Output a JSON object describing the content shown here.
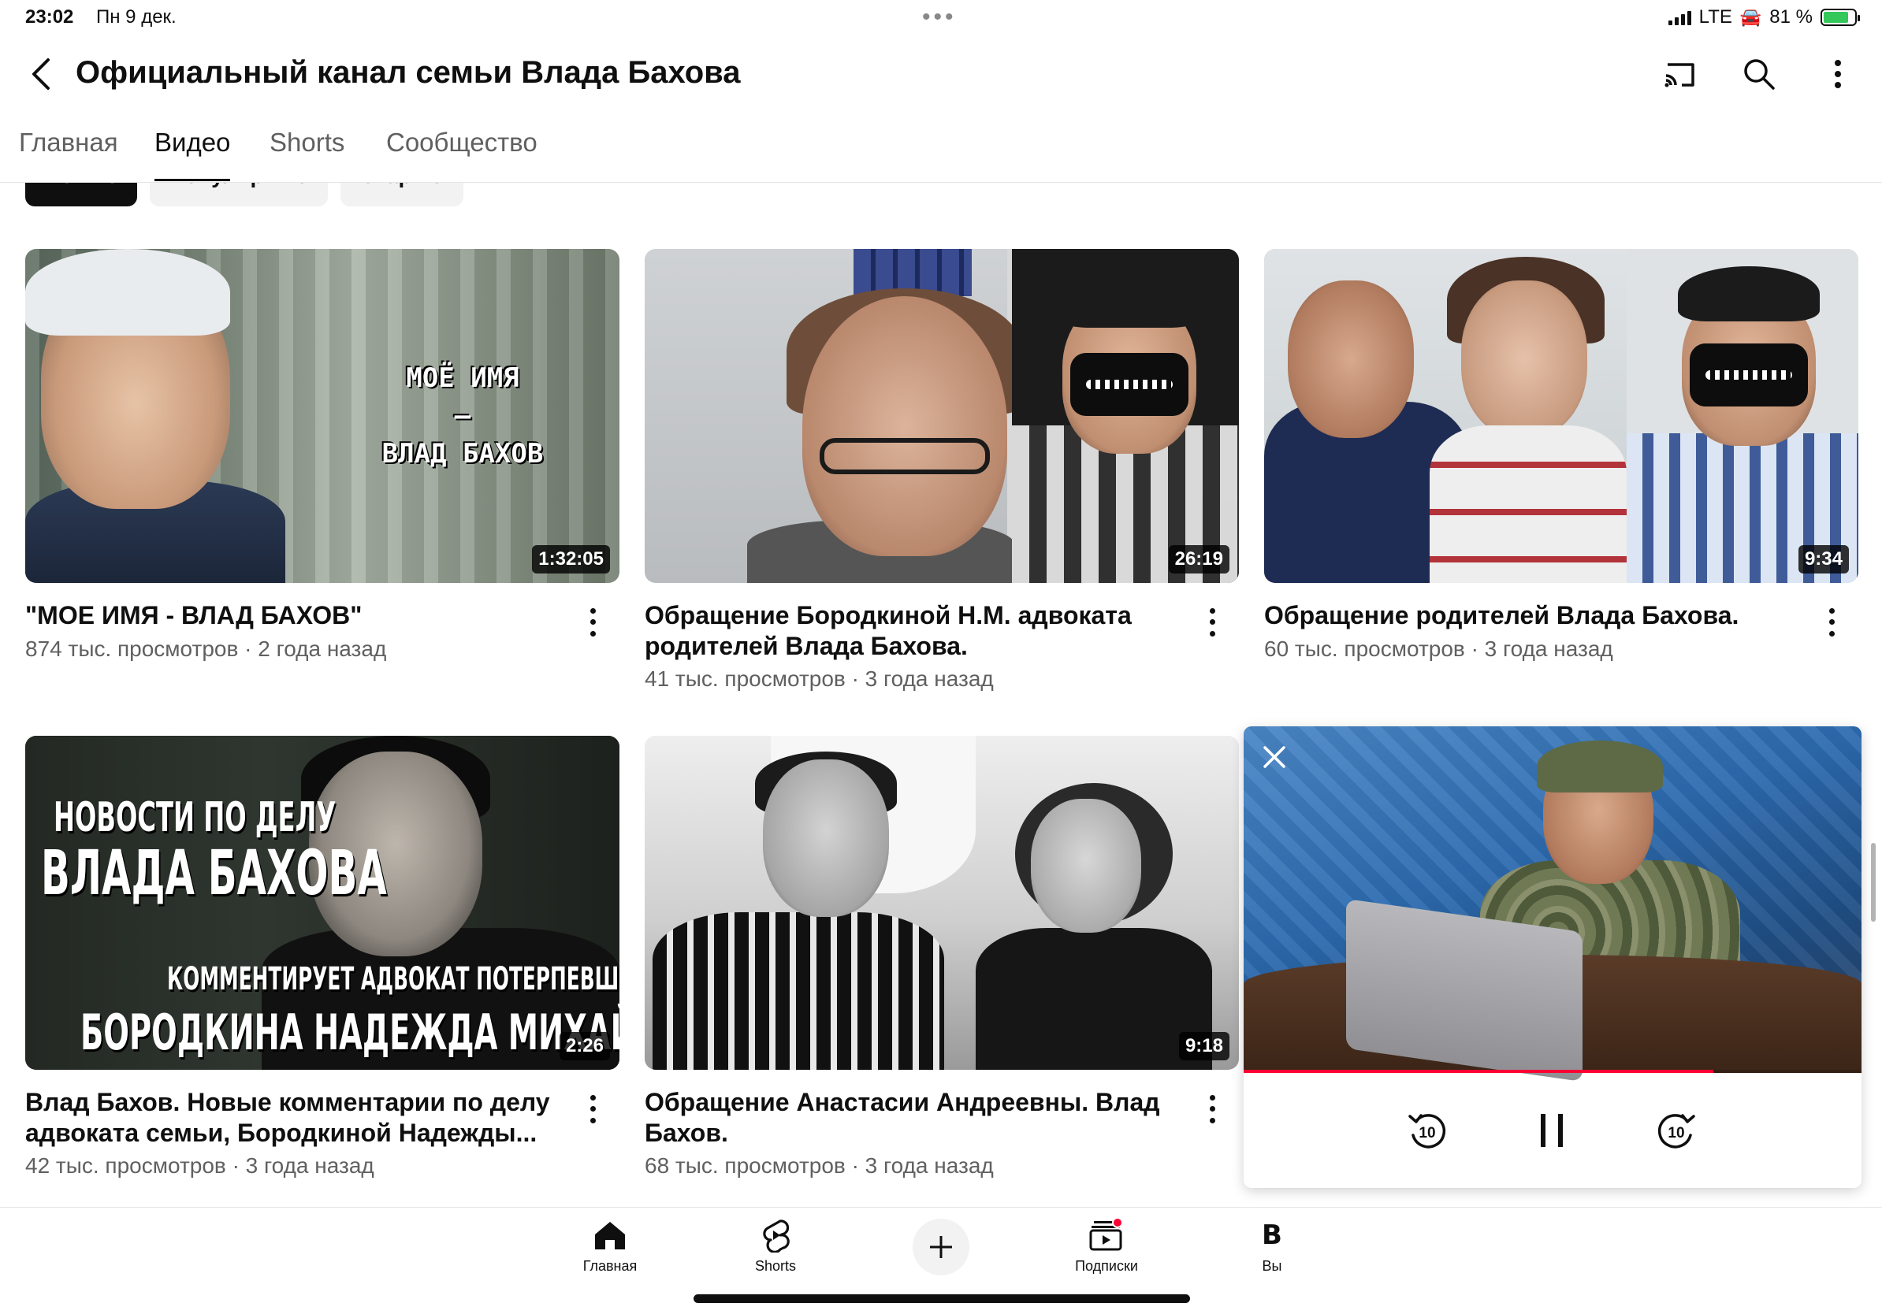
{
  "status_bar": {
    "time": "23:02",
    "date": "Пн 9 дек.",
    "network": "LTE",
    "car_icon": "🚘",
    "battery_percent": "81 %",
    "battery_level": 0.81
  },
  "header": {
    "title": "Официальный канал семьи Влада Бахова",
    "icons": [
      "back-icon",
      "cast-icon",
      "search-icon",
      "more-vert-icon"
    ]
  },
  "tabs": [
    {
      "label": "Главная",
      "active": false
    },
    {
      "label": "Видео",
      "active": true
    },
    {
      "label": "Shorts",
      "active": false
    },
    {
      "label": "Сообщество",
      "active": false
    }
  ],
  "chips": [
    {
      "label": "Новые",
      "active": true
    },
    {
      "label": "Популярные",
      "active": false
    },
    {
      "label": "Старые",
      "active": false
    }
  ],
  "videos": [
    {
      "title": "\"МОЕ ИМЯ - ВЛАД БАХОВ\"",
      "meta": "874 тыс. просмотров · 2 года назад",
      "duration": "1:32:05",
      "thumb_text": [
        "МОЁ  ИМЯ",
        "–",
        "ВЛАД  БАХОВ"
      ]
    },
    {
      "title": "Обращение Бородкиной Н.М. адвоката родителей Влада Бахова.",
      "meta": "41 тыс. просмотров · 3 года назад",
      "duration": "26:19"
    },
    {
      "title": "Обращение родителей Влада Бахова.",
      "meta": "60 тыс. просмотров · 3 года назад",
      "duration": "9:34"
    },
    {
      "title": "Влад Бахов. Новые комментарии по делу адвоката семьи, Бородкиной Надежды...",
      "meta": "42 тыс. просмотров · 3 года назад",
      "duration": "2:26",
      "thumb_text": [
        "НОВОСТИ ПО ДЕЛУ",
        "ВЛАДА БАХОВА",
        "КОММЕНТИРУЕТ АДВОКАТ ПОТЕРПЕВШИХ",
        "БОРОДКИНА НАДЕЖДА МИХАЙЛОВНА"
      ]
    },
    {
      "title": "Обращение Анастасии Андреевны. Влад Бахов.",
      "meta": "68 тыс. просмотров · 3 года назад",
      "duration": "9:18"
    }
  ],
  "miniplayer": {
    "progress": 0.76,
    "rewind_seconds": "10",
    "forward_seconds": "10",
    "icons": [
      "close-icon",
      "rewind-10-icon",
      "pause-icon",
      "forward-10-icon"
    ]
  },
  "bottom_nav": [
    {
      "label": "Главная",
      "icon": "home-icon"
    },
    {
      "label": "Shorts",
      "icon": "shorts-icon"
    },
    {
      "label": "",
      "icon": "create-plus-icon"
    },
    {
      "label": "Подписки",
      "icon": "subscriptions-icon"
    },
    {
      "label": "Вы",
      "icon": "account-letter",
      "letter": "B"
    }
  ],
  "colors": {
    "accent": "#ff0033",
    "text_primary": "#0f0f0f",
    "text_secondary": "#606060",
    "chip_bg": "#f2f2f2"
  }
}
